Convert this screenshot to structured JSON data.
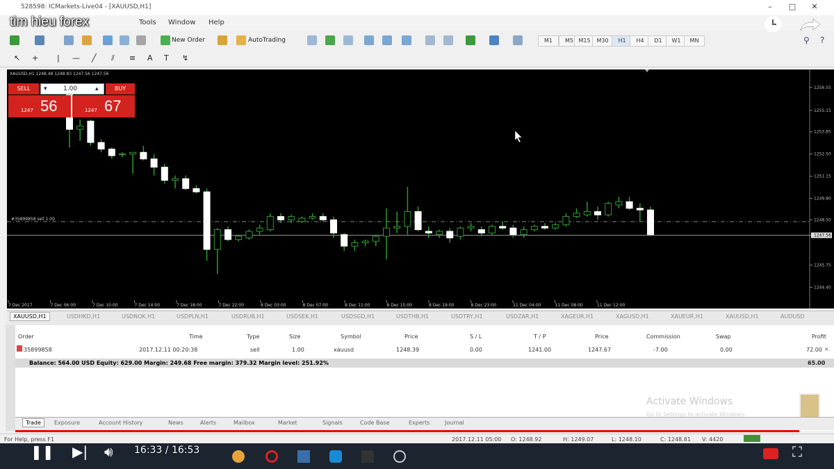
{
  "window": {
    "title": "528598: ICMarkets-Live04 - [XAUUSD,H1]"
  },
  "overlay": {
    "title": "tim hieu forex"
  },
  "menu": {
    "items": [
      "Tools",
      "Window",
      "Help"
    ]
  },
  "toolbar": {
    "new_order": "New Order",
    "autotrading": "AutoTrading",
    "timeframes": [
      "M1",
      "M5",
      "M15",
      "M30",
      "H1",
      "H4",
      "D1",
      "W1",
      "MN"
    ]
  },
  "chart": {
    "header": "XAUUSD,H1  1248.48 1248.83 1247.56 1247.56",
    "trade_panel": {
      "sell_label": "SELL",
      "buy_label": "BUY",
      "lot": "1.00",
      "sell_prefix": "1247",
      "sell_big": "56",
      "buy_prefix": "1247",
      "buy_big": "67"
    },
    "order_line_label": "#35899858 sell 1.00",
    "price_axis": [
      "1256.55",
      "1255.15",
      "1253.85",
      "1252.50",
      "1251.15",
      "1249.80",
      "1248.50",
      "1247.56",
      "1245.75",
      "1244.40"
    ],
    "current_price": "1247.56",
    "time_axis": [
      "7 Dec 2017",
      "7 Dec 06:00",
      "7 Dec 10:00",
      "7 Dec 14:00",
      "7 Dec 18:00",
      "7 Dec 22:00",
      "8 Dec 03:00",
      "8 Dec 07:00",
      "8 Dec 11:00",
      "8 Dec 15:00",
      "8 Dec 19:00",
      "8 Dec 23:00",
      "11 Dec 04:00",
      "11 Dec 08:00",
      "11 Dec 12:00"
    ]
  },
  "chart_data": {
    "type": "candlestick",
    "title": "XAUUSD,H1",
    "ylim": [
      1243.7,
      1257.3
    ],
    "candles": [
      {
        "o": 1256.2,
        "h": 1256.6,
        "l": 1252.9,
        "c": 1254.0
      },
      {
        "o": 1254.0,
        "h": 1254.6,
        "l": 1253.3,
        "c": 1254.2
      },
      {
        "o": 1254.5,
        "h": 1254.6,
        "l": 1253.0,
        "c": 1253.2
      },
      {
        "o": 1253.2,
        "h": 1253.4,
        "l": 1252.6,
        "c": 1252.8
      },
      {
        "o": 1252.8,
        "h": 1252.9,
        "l": 1252.2,
        "c": 1252.4
      },
      {
        "o": 1252.5,
        "h": 1252.6,
        "l": 1252.3,
        "c": 1252.5
      },
      {
        "o": 1252.5,
        "h": 1252.6,
        "l": 1251.3,
        "c": 1252.6
      },
      {
        "o": 1252.6,
        "h": 1253.0,
        "l": 1252.1,
        "c": 1252.2
      },
      {
        "o": 1252.2,
        "h": 1252.5,
        "l": 1251.2,
        "c": 1251.7
      },
      {
        "o": 1251.7,
        "h": 1251.9,
        "l": 1250.7,
        "c": 1250.9
      },
      {
        "o": 1250.9,
        "h": 1251.2,
        "l": 1250.4,
        "c": 1251.0
      },
      {
        "o": 1251.0,
        "h": 1251.2,
        "l": 1250.3,
        "c": 1250.4
      },
      {
        "o": 1250.4,
        "h": 1250.6,
        "l": 1250.1,
        "c": 1250.2
      },
      {
        "o": 1250.2,
        "h": 1250.4,
        "l": 1246.0,
        "c": 1246.7
      },
      {
        "o": 1246.7,
        "h": 1248.0,
        "l": 1245.2,
        "c": 1247.9
      },
      {
        "o": 1247.9,
        "h": 1248.1,
        "l": 1247.2,
        "c": 1247.3
      },
      {
        "o": 1247.3,
        "h": 1247.6,
        "l": 1247.2,
        "c": 1247.5
      },
      {
        "o": 1247.4,
        "h": 1247.9,
        "l": 1247.3,
        "c": 1247.8
      },
      {
        "o": 1247.8,
        "h": 1248.2,
        "l": 1247.6,
        "c": 1248.0
      },
      {
        "o": 1247.9,
        "h": 1248.9,
        "l": 1247.8,
        "c": 1248.7
      },
      {
        "o": 1248.7,
        "h": 1248.9,
        "l": 1248.3,
        "c": 1248.5
      },
      {
        "o": 1248.5,
        "h": 1248.8,
        "l": 1248.3,
        "c": 1248.7
      },
      {
        "o": 1248.4,
        "h": 1248.7,
        "l": 1248.3,
        "c": 1248.6
      },
      {
        "o": 1248.6,
        "h": 1248.9,
        "l": 1248.5,
        "c": 1248.7
      },
      {
        "o": 1248.7,
        "h": 1248.9,
        "l": 1248.4,
        "c": 1248.5
      },
      {
        "o": 1248.5,
        "h": 1248.7,
        "l": 1247.4,
        "c": 1247.7
      },
      {
        "o": 1247.6,
        "h": 1247.7,
        "l": 1246.6,
        "c": 1246.9
      },
      {
        "o": 1246.9,
        "h": 1247.3,
        "l": 1246.6,
        "c": 1247.1
      },
      {
        "o": 1247.1,
        "h": 1247.3,
        "l": 1246.9,
        "c": 1247.2
      },
      {
        "o": 1247.2,
        "h": 1247.6,
        "l": 1246.9,
        "c": 1247.5
      },
      {
        "o": 1247.5,
        "h": 1249.2,
        "l": 1246.1,
        "c": 1248.0
      },
      {
        "o": 1248.0,
        "h": 1249.0,
        "l": 1247.7,
        "c": 1248.1
      },
      {
        "o": 1248.1,
        "h": 1250.5,
        "l": 1247.6,
        "c": 1249.0
      },
      {
        "o": 1249.0,
        "h": 1249.3,
        "l": 1247.8,
        "c": 1247.9
      },
      {
        "o": 1247.8,
        "h": 1248.1,
        "l": 1247.4,
        "c": 1247.7
      },
      {
        "o": 1247.6,
        "h": 1247.9,
        "l": 1247.4,
        "c": 1247.8
      },
      {
        "o": 1247.8,
        "h": 1248.0,
        "l": 1247.1,
        "c": 1247.4
      },
      {
        "o": 1247.5,
        "h": 1248.1,
        "l": 1247.3,
        "c": 1248.0
      },
      {
        "o": 1248.0,
        "h": 1248.3,
        "l": 1247.8,
        "c": 1248.1
      },
      {
        "o": 1247.9,
        "h": 1248.1,
        "l": 1247.5,
        "c": 1247.7
      },
      {
        "o": 1247.7,
        "h": 1248.2,
        "l": 1247.6,
        "c": 1248.1
      },
      {
        "o": 1248.1,
        "h": 1248.4,
        "l": 1247.9,
        "c": 1248.0
      },
      {
        "o": 1248.0,
        "h": 1248.2,
        "l": 1247.4,
        "c": 1247.6
      },
      {
        "o": 1247.6,
        "h": 1248.1,
        "l": 1247.4,
        "c": 1247.9
      },
      {
        "o": 1247.9,
        "h": 1248.2,
        "l": 1247.8,
        "c": 1248.1
      },
      {
        "o": 1248.1,
        "h": 1248.3,
        "l": 1247.9,
        "c": 1248.0
      },
      {
        "o": 1248.0,
        "h": 1248.3,
        "l": 1247.9,
        "c": 1248.2
      },
      {
        "o": 1248.2,
        "h": 1248.9,
        "l": 1248.1,
        "c": 1248.7
      },
      {
        "o": 1248.7,
        "h": 1249.2,
        "l": 1248.6,
        "c": 1248.9
      },
      {
        "o": 1248.8,
        "h": 1249.6,
        "l": 1248.7,
        "c": 1249.0
      },
      {
        "o": 1249.0,
        "h": 1249.3,
        "l": 1248.5,
        "c": 1248.8
      },
      {
        "o": 1248.8,
        "h": 1249.6,
        "l": 1248.7,
        "c": 1249.5
      },
      {
        "o": 1249.4,
        "h": 1249.9,
        "l": 1249.2,
        "c": 1249.6
      },
      {
        "o": 1249.6,
        "h": 1249.9,
        "l": 1249.1,
        "c": 1249.2
      },
      {
        "o": 1249.2,
        "h": 1249.5,
        "l": 1248.4,
        "c": 1249.1
      },
      {
        "o": 1249.1,
        "h": 1249.3,
        "l": 1247.5,
        "c": 1247.6
      }
    ]
  },
  "symbol_tabs": [
    "XAUUSD,H1",
    "USDHKD,H1",
    "USDNOK,H1",
    "USDPLN,H1",
    "USDRUB,H1",
    "USDSEK,H1",
    "USDSGD,H1",
    "USDTHB,H1",
    "USDTRY,H1",
    "USDZAR,H1",
    "XAGEUR,H1",
    "XAGUSD,H1",
    "XAUEUR,H1",
    "XAUUSD,H1",
    "AUDUSD"
  ],
  "terminal": {
    "headers": [
      "Order",
      "Time",
      "Type",
      "Size",
      "Symbol",
      "Price",
      "S / L",
      "T / P",
      "Price",
      "Commission",
      "Swap",
      "Profit"
    ],
    "row": [
      "35899858",
      "2017.12.11 00:20:38",
      "sell",
      "1.00",
      "xauusd",
      "1248.39",
      "0.00",
      "1241.00",
      "1247.67",
      "-7.00",
      "0.00",
      "72.00"
    ],
    "balance": "Balance: 564.00 USD  Equity: 629.00  Margin: 249.68  Free margin: 379.32  Margin level: 251.92%",
    "balance_profit": "65.00",
    "tabs": [
      "Trade",
      "Exposure",
      "Account History",
      "News",
      "Alerts",
      "Mailbox",
      "Market",
      "Signals",
      "Code Base",
      "Experts",
      "Journal"
    ]
  },
  "watermark": {
    "line1": "Activate Windows",
    "line2": "Go to Settings to activate Windows."
  },
  "statusbar": {
    "help": "For Help, press F1",
    "datetime": "2017.12.11 05:00",
    "open": "O: 1248.92",
    "high": "H: 1249.07",
    "low": "L: 1248.10",
    "close": "C: 1248.81",
    "volume": "V: 4420"
  },
  "player": {
    "time": "16:33 / 16:53"
  }
}
